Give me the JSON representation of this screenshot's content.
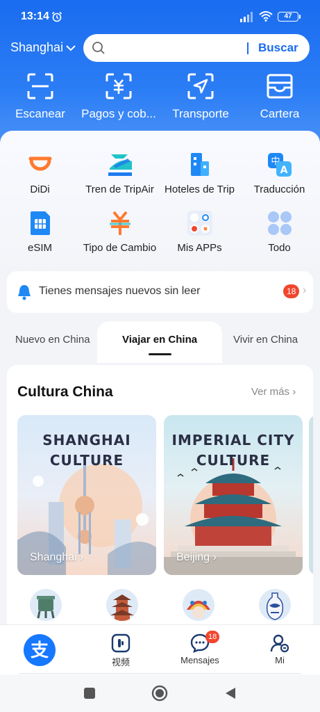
{
  "status_bar": {
    "time": "13:14",
    "battery": "47"
  },
  "header": {
    "city": "Shanghai",
    "search_placeholder": "",
    "search_button": "Buscar",
    "quick_actions": [
      {
        "label": "Escanear",
        "icon": "scan-icon"
      },
      {
        "label": "Pagos y cob...",
        "icon": "payment-icon"
      },
      {
        "label": "Transporte",
        "icon": "transport-icon"
      },
      {
        "label": "Cartera",
        "icon": "wallet-icon"
      }
    ]
  },
  "services": [
    {
      "label": "DiDi",
      "icon": "didi-icon"
    },
    {
      "label": "Tren de TripAir",
      "icon": "train-icon"
    },
    {
      "label": "Hoteles de Trip",
      "icon": "hotel-icon"
    },
    {
      "label": "Traducción",
      "icon": "translate-icon"
    },
    {
      "label": "eSIM",
      "icon": "esim-icon"
    },
    {
      "label": "Tipo de Cambio",
      "icon": "exchange-icon"
    },
    {
      "label": "Mis APPs",
      "icon": "my-apps-icon"
    },
    {
      "label": "Todo",
      "icon": "all-icon"
    }
  ],
  "notice": {
    "text": "Tienes mensajes nuevos sin leer",
    "count": "18"
  },
  "tabs": [
    "Nuevo en China",
    "Viajar en China",
    "Vivir en China"
  ],
  "culture": {
    "title": "Cultura China",
    "more": "Ver más",
    "cards": [
      {
        "title_line1": "SHANGHAI",
        "title_line2": "CULTURE",
        "label": "Shanghai ›"
      },
      {
        "title_line1": "IMPERIAL CITY",
        "title_line2": "CULTURE",
        "label": "Beijing ›"
      }
    ]
  },
  "bottom_nav": {
    "items": [
      {
        "label": "",
        "icon": "alipay-icon"
      },
      {
        "label": "视频",
        "icon": "video-icon"
      },
      {
        "label": "Mensajes",
        "icon": "messages-icon",
        "badge": "18"
      },
      {
        "label": "Mi",
        "icon": "profile-icon"
      }
    ]
  },
  "colors": {
    "primary": "#1a6cf0",
    "badge": "#f0462d",
    "didi": "#ff7a2f"
  }
}
